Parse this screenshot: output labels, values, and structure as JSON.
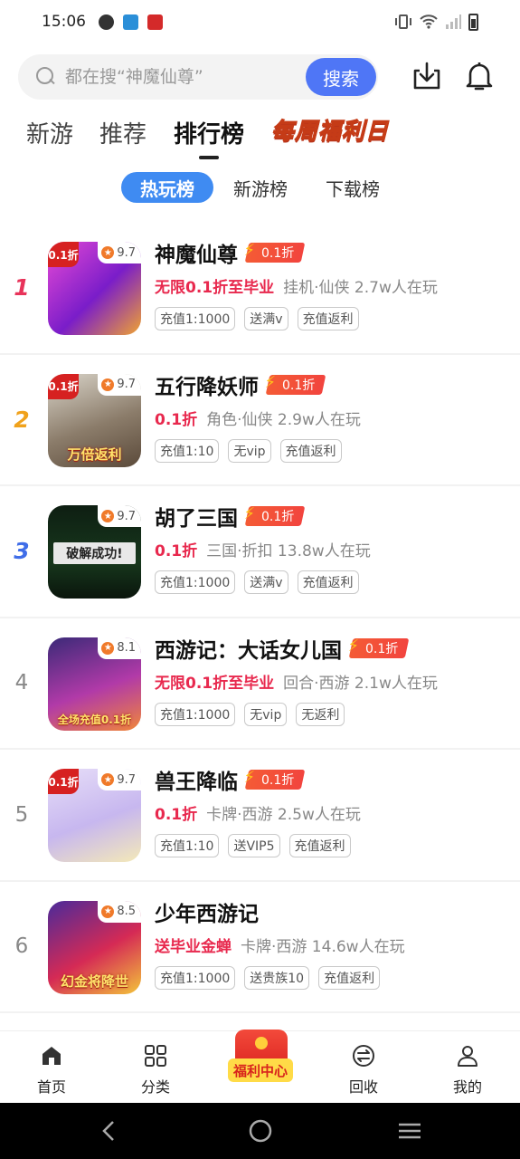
{
  "status": {
    "time": "15:06"
  },
  "search": {
    "placeholder": "都在搜“神魔仙尊”",
    "button": "搜索"
  },
  "tabs": {
    "items": [
      "新游",
      "推荐",
      "排行榜"
    ],
    "weekly": "每周福利日"
  },
  "subtabs": [
    "热玩榜",
    "新游榜",
    "下载榜"
  ],
  "games": [
    {
      "rank": "1",
      "name": "神魔仙尊",
      "discount": "0.1折",
      "score": "9.7",
      "corner": "0.1折",
      "caption": "",
      "promo": "无限0.1折至毕业",
      "meta": "挂机·仙侠  2.7w人在玩",
      "chips": [
        "充值1:1000",
        "送满v",
        "充值返利"
      ],
      "art": "linear-gradient(135deg,#e84ad6,#7a1dc9 55%,#f0a331)"
    },
    {
      "rank": "2",
      "name": "五行降妖师",
      "discount": "0.1折",
      "score": "9.7",
      "corner": "0.1折",
      "caption": "万倍返利",
      "promo": "0.1折",
      "meta": "角色·仙侠  2.9w人在玩",
      "chips": [
        "充值1:10",
        "无vip",
        "充值返利"
      ],
      "art": "linear-gradient(160deg,#d9d4c9,#8b7c6a 55%,#5b4a3a)"
    },
    {
      "rank": "3",
      "name": "胡了三国",
      "discount": "0.1折",
      "score": "9.7",
      "corner": "",
      "caption": "破解成功!",
      "promo": "0.1折",
      "meta": "三国·折扣  13.8w人在玩",
      "chips": [
        "充值1:1000",
        "送满v",
        "充值返利"
      ],
      "art": "linear-gradient(180deg,#0e1e12,#17381d 60%,#0a150c)"
    },
    {
      "rank": "4",
      "name": "西游记：大话女儿国",
      "discount": "0.1折",
      "score": "8.1",
      "corner": "",
      "caption": "全场充值0.1折",
      "promo": "无限0.1折至毕业",
      "meta": "回合·西游  2.1w人在玩",
      "chips": [
        "充值1:1000",
        "无vip",
        "无返利"
      ],
      "art": "linear-gradient(160deg,#3b2a78,#b13aa8 55%,#f0863a)"
    },
    {
      "rank": "5",
      "name": "兽王降临",
      "discount": "0.1折",
      "score": "9.7",
      "corner": "0.1折",
      "caption": "",
      "promo": "0.1折",
      "meta": "卡牌·西游  2.5w人在玩",
      "chips": [
        "充值1:10",
        "送VIP5",
        "充值返利"
      ],
      "art": "linear-gradient(160deg,#e7def8,#c7b7ef 55%,#f4e9b8)"
    },
    {
      "rank": "6",
      "name": "少年西游记",
      "discount": "",
      "score": "8.5",
      "corner": "",
      "caption": "幻金将降世",
      "promo": "送毕业金蝉",
      "meta": "卡牌·西游  14.6w人在玩",
      "chips": [
        "充值1:1000",
        "送贵族10",
        "充值返利"
      ],
      "art": "linear-gradient(150deg,#4a2a9a,#d52a55 55%,#f3c43a)"
    }
  ],
  "bottom_nav": [
    "首页",
    "分类",
    "福利中心",
    "回收",
    "我的"
  ]
}
